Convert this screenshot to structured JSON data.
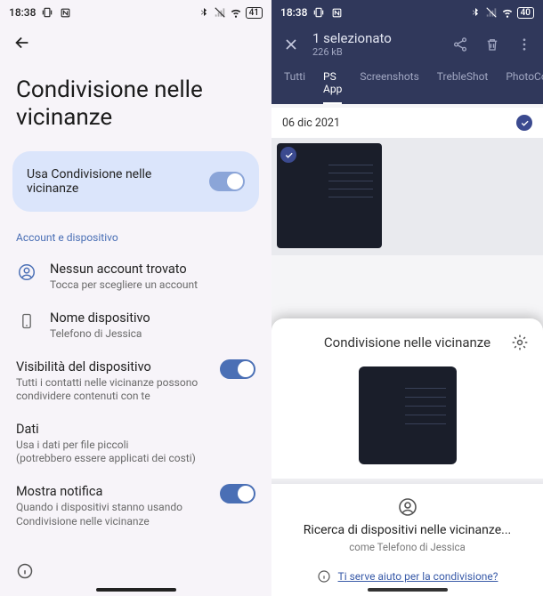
{
  "left": {
    "statusbar": {
      "time": "18:38",
      "battery": "41"
    },
    "title": "Condivisione nelle vicinanze",
    "mainToggle": {
      "label": "Usa Condivisione nelle vicinanze",
      "on": true
    },
    "sectionLabel": "Account e dispositivo",
    "account": {
      "title": "Nessun account trovato",
      "sub": "Tocca per scegliere un account"
    },
    "device": {
      "title": "Nome dispositivo",
      "sub": "Telefono di Jessica"
    },
    "visibility": {
      "title": "Visibilità del dispositivo",
      "sub": "Tutti i contatti nelle vicinanze possono condividere contenuti con te",
      "on": true
    },
    "data": {
      "title": "Dati",
      "sub": "Usa i dati per file piccoli\n(potrebbero essere applicati dei costi)"
    },
    "notify": {
      "title": "Mostra notifica",
      "sub": "Quando i dispositivi stanno usando Condivisione nelle vicinanze",
      "on": true
    }
  },
  "right": {
    "statusbar": {
      "time": "18:38",
      "battery": "40"
    },
    "appbar": {
      "title": "1 selezionato",
      "sub": "226 kB"
    },
    "tabs": [
      "Tutti",
      "PS App",
      "Screenshots",
      "TrebleShot",
      "PhotoCon"
    ],
    "activeTab": 1,
    "dateHeader": "06 dic 2021",
    "sheet": {
      "title": "Condivisione nelle vicinanze",
      "searchTitle": "Ricerca di dispositivi nelle vicinanze...",
      "searchSub": "come Telefono di Jessica",
      "helpLink": "Ti serve aiuto per la condivisione?"
    }
  }
}
